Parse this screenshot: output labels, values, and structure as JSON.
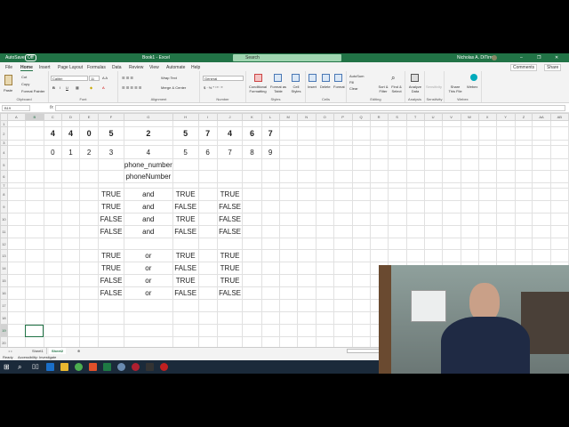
{
  "titlebar": {
    "autosave": "AutoSave",
    "autosave_state": "Off",
    "title": "Book1 - Excel",
    "search": "Search",
    "user": "Nicholas A. DiTirro"
  },
  "menu": [
    "File",
    "Home",
    "Insert",
    "Page Layout",
    "Formulas",
    "Data",
    "Review",
    "View",
    "Automate",
    "Help"
  ],
  "comments": "Comments",
  "share": "Share",
  "ribbon": {
    "clipboard": {
      "label": "Clipboard",
      "paste": "Paste",
      "cut": "Cut",
      "copy": "Copy",
      "format_painter": "Format Painter"
    },
    "font": {
      "label": "Font",
      "name": "Calibri",
      "size": "11"
    },
    "alignment": {
      "label": "Alignment",
      "wrap": "Wrap Text",
      "merge": "Merge & Center"
    },
    "number": {
      "label": "Number",
      "format": "General"
    },
    "styles": {
      "label": "Styles",
      "conditional": "Conditional Formatting",
      "format_table": "Format as Table",
      "cell_styles": "Cell Styles"
    },
    "cells": {
      "label": "Cells",
      "insert": "Insert",
      "delete": "Delete",
      "format": "Format"
    },
    "editing": {
      "label": "Editing",
      "autosum": "AutoSum",
      "fill": "Fill",
      "clear": "Clear",
      "sort": "Sort & Filter",
      "find": "Find & Select"
    },
    "analysis": {
      "label": "Analysis",
      "analyze": "Analyze Data"
    },
    "sensitivity": {
      "label": "Sensitivity",
      "btn": "Sensitivity"
    },
    "webex": {
      "label": "Webex",
      "share": "Share This File",
      "webex": "Webex"
    }
  },
  "formula": {
    "namebox": "B19",
    "fx": "fx",
    "value": ""
  },
  "columns": [
    "A",
    "B",
    "C",
    "D",
    "E",
    "F",
    "G",
    "H",
    "I",
    "J",
    "K",
    "L",
    "M",
    "N",
    "O",
    "P",
    "Q",
    "R",
    "S",
    "T",
    "U",
    "V",
    "W",
    "X",
    "Y",
    "Z",
    "AA",
    "AB"
  ],
  "rows": [
    "1",
    "2",
    "3",
    "4",
    "5",
    "6",
    "7",
    "8",
    "9",
    "10",
    "11",
    "12",
    "13",
    "14",
    "15",
    "16",
    "17",
    "18",
    "19",
    "20"
  ],
  "cells": {
    "C2": "4",
    "D2": "4",
    "E2": "0",
    "F2": "5",
    "G2": "2",
    "H2": "5",
    "I2": "7",
    "J2": "4",
    "K2": "6",
    "L2": "7",
    "C4": "0",
    "D4": "1",
    "E4": "2",
    "F4": "3",
    "G4": "4",
    "H4": "5",
    "I4": "6",
    "J4": "7",
    "K4": "8",
    "L4": "9",
    "G5": "phone_number",
    "G6": "phoneNumber",
    "F8": "TRUE",
    "G8": "and",
    "H8": "TRUE",
    "J8": "TRUE",
    "F9": "TRUE",
    "G9": "and",
    "H9": "FALSE",
    "J9": "FALSE",
    "F10": "FALSE",
    "G10": "and",
    "H10": "TRUE",
    "J10": "FALSE",
    "F11": "FALSE",
    "G11": "and",
    "H11": "FALSE",
    "J11": "FALSE",
    "F13": "TRUE",
    "G13": "or",
    "H13": "TRUE",
    "J13": "TRUE",
    "F14": "TRUE",
    "G14": "or",
    "H14": "FALSE",
    "J14": "TRUE",
    "F15": "FALSE",
    "G15": "or",
    "H15": "TRUE",
    "J15": "TRUE",
    "F16": "FALSE",
    "G16": "or",
    "H16": "FALSE",
    "J16": "FALSE"
  },
  "selected_cell": "B19",
  "sheets": [
    "Sheet1",
    "Sheet2"
  ],
  "active_sheet": "Sheet2",
  "status": {
    "ready": "Ready",
    "accessibility": "Accessibility: Investigate"
  },
  "colors": {
    "excel_green": "#217346"
  }
}
